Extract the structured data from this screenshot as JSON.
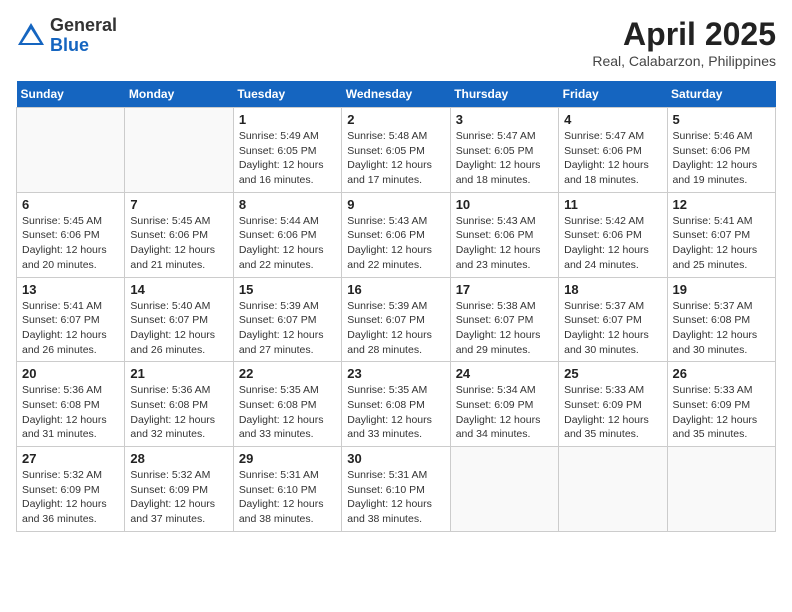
{
  "header": {
    "logo_general": "General",
    "logo_blue": "Blue",
    "title": "April 2025",
    "location": "Real, Calabarzon, Philippines"
  },
  "calendar": {
    "days_of_week": [
      "Sunday",
      "Monday",
      "Tuesday",
      "Wednesday",
      "Thursday",
      "Friday",
      "Saturday"
    ],
    "weeks": [
      [
        {
          "day": "",
          "info": ""
        },
        {
          "day": "",
          "info": ""
        },
        {
          "day": "1",
          "sunrise": "Sunrise: 5:49 AM",
          "sunset": "Sunset: 6:05 PM",
          "daylight": "Daylight: 12 hours and 16 minutes."
        },
        {
          "day": "2",
          "sunrise": "Sunrise: 5:48 AM",
          "sunset": "Sunset: 6:05 PM",
          "daylight": "Daylight: 12 hours and 17 minutes."
        },
        {
          "day": "3",
          "sunrise": "Sunrise: 5:47 AM",
          "sunset": "Sunset: 6:05 PM",
          "daylight": "Daylight: 12 hours and 18 minutes."
        },
        {
          "day": "4",
          "sunrise": "Sunrise: 5:47 AM",
          "sunset": "Sunset: 6:06 PM",
          "daylight": "Daylight: 12 hours and 18 minutes."
        },
        {
          "day": "5",
          "sunrise": "Sunrise: 5:46 AM",
          "sunset": "Sunset: 6:06 PM",
          "daylight": "Daylight: 12 hours and 19 minutes."
        }
      ],
      [
        {
          "day": "6",
          "sunrise": "Sunrise: 5:45 AM",
          "sunset": "Sunset: 6:06 PM",
          "daylight": "Daylight: 12 hours and 20 minutes."
        },
        {
          "day": "7",
          "sunrise": "Sunrise: 5:45 AM",
          "sunset": "Sunset: 6:06 PM",
          "daylight": "Daylight: 12 hours and 21 minutes."
        },
        {
          "day": "8",
          "sunrise": "Sunrise: 5:44 AM",
          "sunset": "Sunset: 6:06 PM",
          "daylight": "Daylight: 12 hours and 22 minutes."
        },
        {
          "day": "9",
          "sunrise": "Sunrise: 5:43 AM",
          "sunset": "Sunset: 6:06 PM",
          "daylight": "Daylight: 12 hours and 22 minutes."
        },
        {
          "day": "10",
          "sunrise": "Sunrise: 5:43 AM",
          "sunset": "Sunset: 6:06 PM",
          "daylight": "Daylight: 12 hours and 23 minutes."
        },
        {
          "day": "11",
          "sunrise": "Sunrise: 5:42 AM",
          "sunset": "Sunset: 6:06 PM",
          "daylight": "Daylight: 12 hours and 24 minutes."
        },
        {
          "day": "12",
          "sunrise": "Sunrise: 5:41 AM",
          "sunset": "Sunset: 6:07 PM",
          "daylight": "Daylight: 12 hours and 25 minutes."
        }
      ],
      [
        {
          "day": "13",
          "sunrise": "Sunrise: 5:41 AM",
          "sunset": "Sunset: 6:07 PM",
          "daylight": "Daylight: 12 hours and 26 minutes."
        },
        {
          "day": "14",
          "sunrise": "Sunrise: 5:40 AM",
          "sunset": "Sunset: 6:07 PM",
          "daylight": "Daylight: 12 hours and 26 minutes."
        },
        {
          "day": "15",
          "sunrise": "Sunrise: 5:39 AM",
          "sunset": "Sunset: 6:07 PM",
          "daylight": "Daylight: 12 hours and 27 minutes."
        },
        {
          "day": "16",
          "sunrise": "Sunrise: 5:39 AM",
          "sunset": "Sunset: 6:07 PM",
          "daylight": "Daylight: 12 hours and 28 minutes."
        },
        {
          "day": "17",
          "sunrise": "Sunrise: 5:38 AM",
          "sunset": "Sunset: 6:07 PM",
          "daylight": "Daylight: 12 hours and 29 minutes."
        },
        {
          "day": "18",
          "sunrise": "Sunrise: 5:37 AM",
          "sunset": "Sunset: 6:07 PM",
          "daylight": "Daylight: 12 hours and 30 minutes."
        },
        {
          "day": "19",
          "sunrise": "Sunrise: 5:37 AM",
          "sunset": "Sunset: 6:08 PM",
          "daylight": "Daylight: 12 hours and 30 minutes."
        }
      ],
      [
        {
          "day": "20",
          "sunrise": "Sunrise: 5:36 AM",
          "sunset": "Sunset: 6:08 PM",
          "daylight": "Daylight: 12 hours and 31 minutes."
        },
        {
          "day": "21",
          "sunrise": "Sunrise: 5:36 AM",
          "sunset": "Sunset: 6:08 PM",
          "daylight": "Daylight: 12 hours and 32 minutes."
        },
        {
          "day": "22",
          "sunrise": "Sunrise: 5:35 AM",
          "sunset": "Sunset: 6:08 PM",
          "daylight": "Daylight: 12 hours and 33 minutes."
        },
        {
          "day": "23",
          "sunrise": "Sunrise: 5:35 AM",
          "sunset": "Sunset: 6:08 PM",
          "daylight": "Daylight: 12 hours and 33 minutes."
        },
        {
          "day": "24",
          "sunrise": "Sunrise: 5:34 AM",
          "sunset": "Sunset: 6:09 PM",
          "daylight": "Daylight: 12 hours and 34 minutes."
        },
        {
          "day": "25",
          "sunrise": "Sunrise: 5:33 AM",
          "sunset": "Sunset: 6:09 PM",
          "daylight": "Daylight: 12 hours and 35 minutes."
        },
        {
          "day": "26",
          "sunrise": "Sunrise: 5:33 AM",
          "sunset": "Sunset: 6:09 PM",
          "daylight": "Daylight: 12 hours and 35 minutes."
        }
      ],
      [
        {
          "day": "27",
          "sunrise": "Sunrise: 5:32 AM",
          "sunset": "Sunset: 6:09 PM",
          "daylight": "Daylight: 12 hours and 36 minutes."
        },
        {
          "day": "28",
          "sunrise": "Sunrise: 5:32 AM",
          "sunset": "Sunset: 6:09 PM",
          "daylight": "Daylight: 12 hours and 37 minutes."
        },
        {
          "day": "29",
          "sunrise": "Sunrise: 5:31 AM",
          "sunset": "Sunset: 6:10 PM",
          "daylight": "Daylight: 12 hours and 38 minutes."
        },
        {
          "day": "30",
          "sunrise": "Sunrise: 5:31 AM",
          "sunset": "Sunset: 6:10 PM",
          "daylight": "Daylight: 12 hours and 38 minutes."
        },
        {
          "day": "",
          "info": ""
        },
        {
          "day": "",
          "info": ""
        },
        {
          "day": "",
          "info": ""
        }
      ]
    ]
  }
}
